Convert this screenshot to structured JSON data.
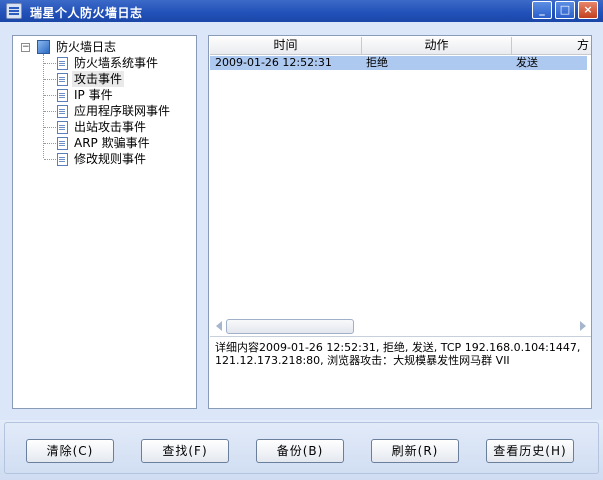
{
  "window": {
    "title": "瑞星个人防火墙日志",
    "controls": {
      "minimize": "_",
      "maximize": "□",
      "close": "×"
    }
  },
  "tree": {
    "root": "防火墙日志",
    "root_expander": "−",
    "items": [
      {
        "label": "防火墙系统事件",
        "selected": false
      },
      {
        "label": "攻击事件",
        "selected": true
      },
      {
        "label": "IP 事件",
        "selected": false
      },
      {
        "label": "应用程序联网事件",
        "selected": false
      },
      {
        "label": "出站攻击事件",
        "selected": false
      },
      {
        "label": "ARP 欺骗事件",
        "selected": false
      },
      {
        "label": "修改规则事件",
        "selected": false
      }
    ]
  },
  "log_list": {
    "columns": [
      "时间",
      "动作",
      "方"
    ],
    "rows": [
      {
        "time": "2009-01-26 12:52:31",
        "action": "拒绝",
        "direction": "发送",
        "selected": true
      }
    ]
  },
  "detail": {
    "text": "详细内容2009-01-26 12:52:31, 拒绝, 发送, TCP 192.168.0.104:1447, 121.12.173.218:80, 浏览器攻击：大规模暴发性网马群 VII"
  },
  "buttons": {
    "clear": "清除(C)",
    "find": "查找(F)",
    "backup": "备份(B)",
    "refresh": "刷新(R)",
    "history": "查看历史(H)"
  },
  "colors": {
    "titlebar": "#2150b8",
    "selection": "#aec9f0",
    "background": "#dbe7f8"
  }
}
